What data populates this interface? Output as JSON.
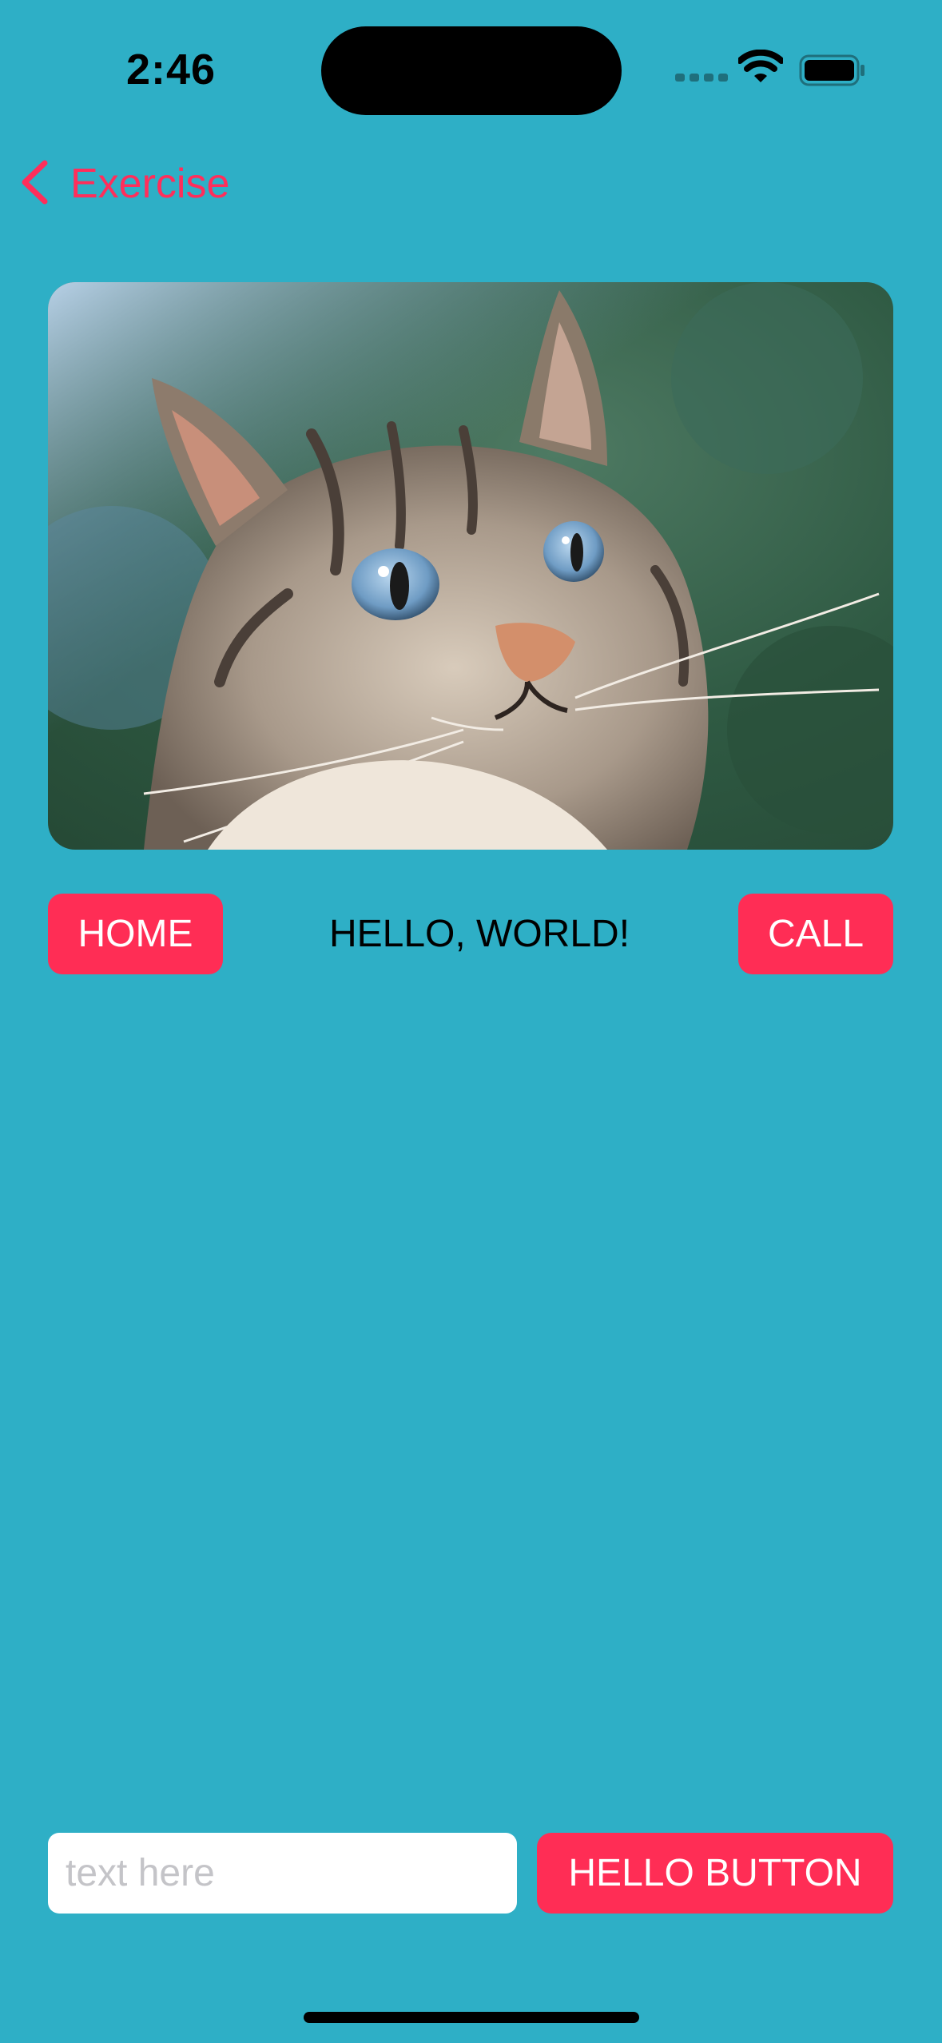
{
  "status_bar": {
    "time": "2:46",
    "icons": [
      "cellular-signal-icon",
      "wifi-icon",
      "battery-icon"
    ]
  },
  "nav": {
    "back_label": "Exercise",
    "back_icon": "chevron-left-icon"
  },
  "image": {
    "subject": "cat photo"
  },
  "buttons": {
    "home": "HOME",
    "call": "CALL",
    "hello": "HELLO BUTTON"
  },
  "greeting": "HELLO, WORLD!",
  "input": {
    "placeholder": "text here",
    "value": ""
  },
  "colors": {
    "background": "#2eafc6",
    "accent": "#ff2d55",
    "text": "#000000",
    "input_background": "#ffffff"
  }
}
